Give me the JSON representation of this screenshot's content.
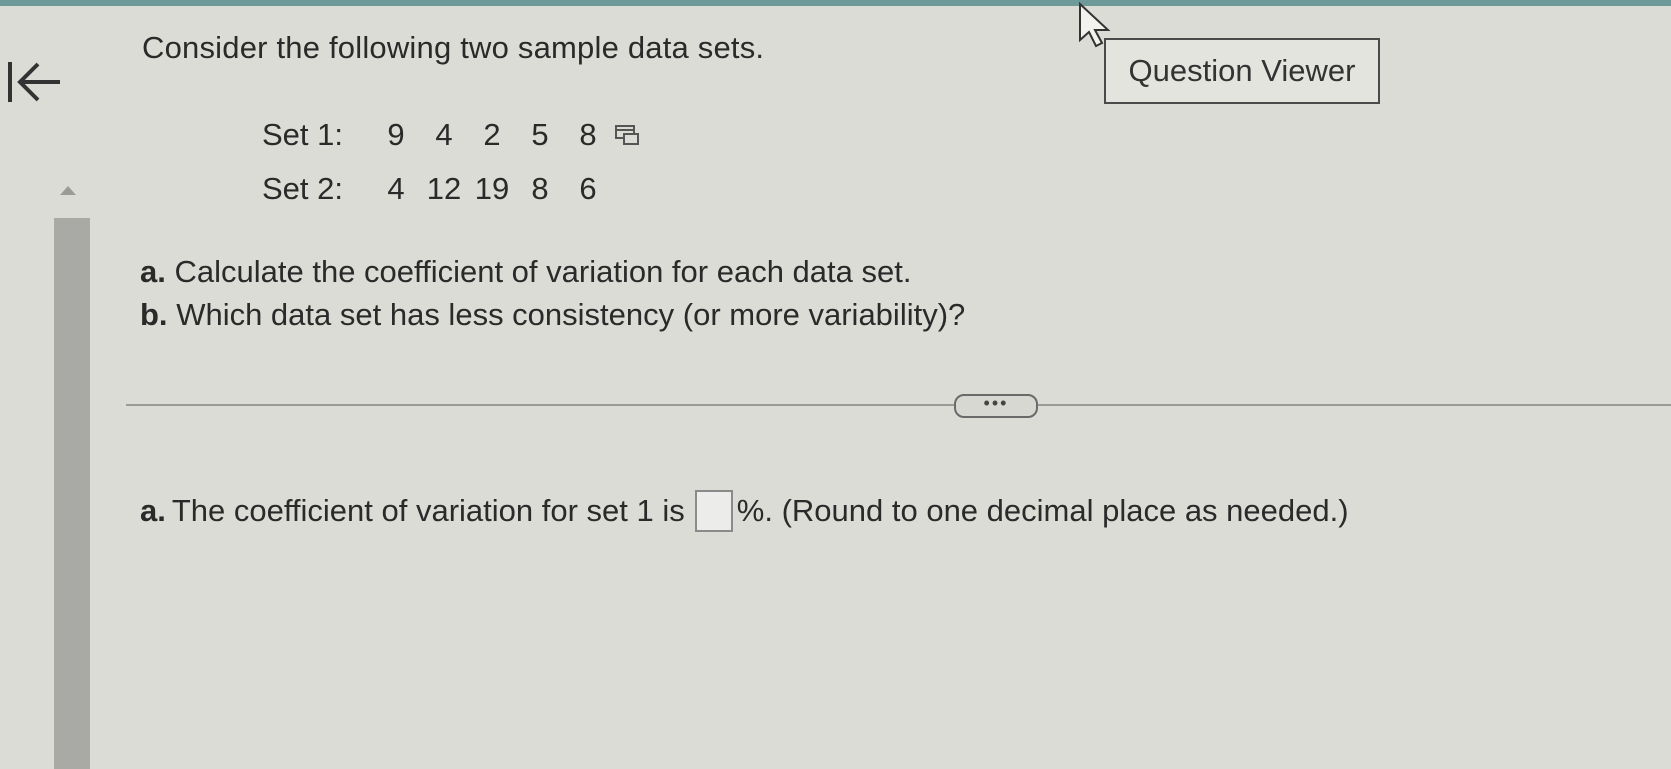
{
  "toolbar": {
    "question_viewer_label": "Question Viewer"
  },
  "question": {
    "intro": "Consider the following two sample data sets.",
    "sets": [
      {
        "label": "Set 1:",
        "values": [
          "9",
          "4",
          "2",
          "5",
          "8"
        ]
      },
      {
        "label": "Set 2:",
        "values": [
          "4",
          "12",
          "19",
          "8",
          "6"
        ]
      }
    ],
    "part_a": {
      "prefix": "a.",
      "text": "Calculate the coefficient of variation for each data set."
    },
    "part_b": {
      "prefix": "b.",
      "text": "Which data set has less consistency (or more variability)?"
    }
  },
  "answer": {
    "prefix": "a.",
    "text_before": "The coefficient of variation for set 1 is",
    "input_value": "",
    "text_after": "%. (Round to one decimal place as needed.)"
  },
  "divider": {
    "handle_label": "•••"
  },
  "icons": {
    "back": "back-to-start-icon",
    "copy": "copy-data-icon",
    "cursor": "mouse-pointer-icon"
  },
  "colors": {
    "background": "#dcdcd6",
    "scroll_thumb": "#a9a9a6",
    "top_edge": "#6f9a9a"
  }
}
